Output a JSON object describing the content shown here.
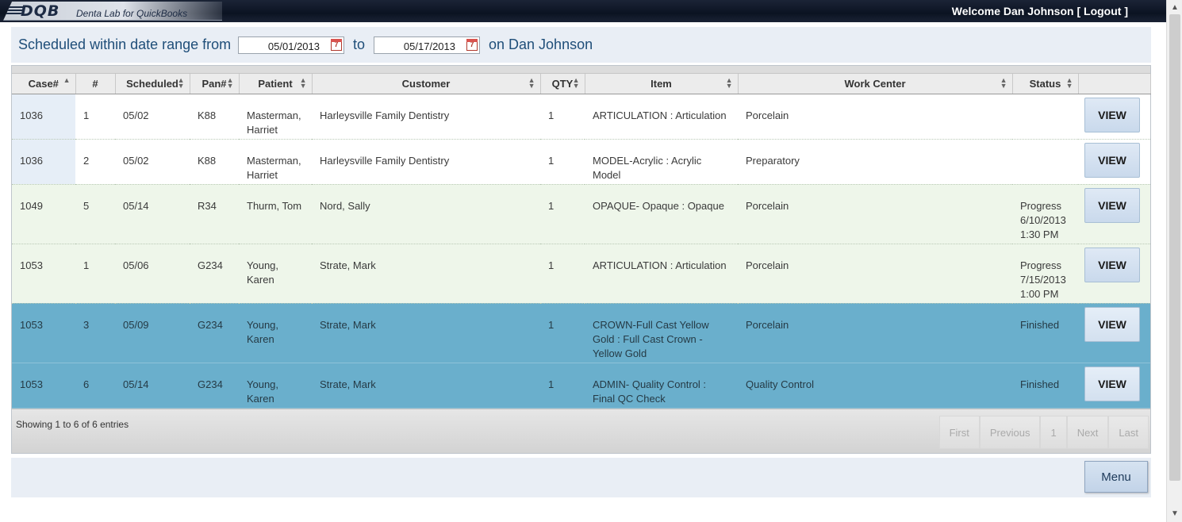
{
  "header": {
    "logo": "DQB",
    "app_name": "Denta Lab for QuickBooks",
    "welcome": "Welcome Dan Johnson",
    "logout": "[ Logout ]"
  },
  "filter": {
    "prefix": "Scheduled within date range from",
    "from_date": "05/01/2013",
    "to_label": "to",
    "to_date": "05/17/2013",
    "suffix": "on Dan Johnson",
    "calendar_glyph": "7"
  },
  "table": {
    "columns": [
      "Case#",
      "#",
      "Scheduled",
      "Pan#",
      "Patient",
      "Customer",
      "QTY",
      "Item",
      "Work Center",
      "Status",
      ""
    ],
    "view_label": "VIEW",
    "rows": [
      {
        "case": "1036",
        "num": "1",
        "scheduled": "05/02",
        "pan": "K88",
        "patient": "Masterman, Harriet",
        "customer": "Harleysville Family Dentistry",
        "qty": "1",
        "item": "ARTICULATION : Articulation",
        "work_center": "Porcelain",
        "status": ""
      },
      {
        "case": "1036",
        "num": "2",
        "scheduled": "05/02",
        "pan": "K88",
        "patient": "Masterman, Harriet",
        "customer": "Harleysville Family Dentistry",
        "qty": "1",
        "item": "MODEL-Acrylic : Acrylic Model",
        "work_center": "Preparatory",
        "status": ""
      },
      {
        "case": "1049",
        "num": "5",
        "scheduled": "05/14",
        "pan": "R34",
        "patient": "Thurm, Tom",
        "customer": "Nord, Sally",
        "qty": "1",
        "item": "OPAQUE- Opaque : Opaque",
        "work_center": "Porcelain",
        "status": "Progress 6/10/2013 1:30 PM"
      },
      {
        "case": "1053",
        "num": "1",
        "scheduled": "05/06",
        "pan": "G234",
        "patient": "Young, Karen",
        "customer": "Strate, Mark",
        "qty": "1",
        "item": "ARTICULATION : Articulation",
        "work_center": "Porcelain",
        "status": "Progress 7/15/2013 1:00 PM"
      },
      {
        "case": "1053",
        "num": "3",
        "scheduled": "05/09",
        "pan": "G234",
        "patient": "Young, Karen",
        "customer": "Strate, Mark",
        "qty": "1",
        "item": "CROWN-Full Cast Yellow Gold : Full Cast Crown - Yellow Gold",
        "work_center": "Porcelain",
        "status": "Finished"
      },
      {
        "case": "1053",
        "num": "6",
        "scheduled": "05/14",
        "pan": "G234",
        "patient": "Young, Karen",
        "customer": "Strate, Mark",
        "qty": "1",
        "item": "ADMIN- Quality Control : Final QC Check",
        "work_center": "Quality Control",
        "status": "Finished"
      }
    ]
  },
  "footer": {
    "showing": "Showing 1 to 6 of 6 entries",
    "pager": [
      "First",
      "Previous",
      "1",
      "Next",
      "Last"
    ]
  },
  "menu_label": "Menu"
}
